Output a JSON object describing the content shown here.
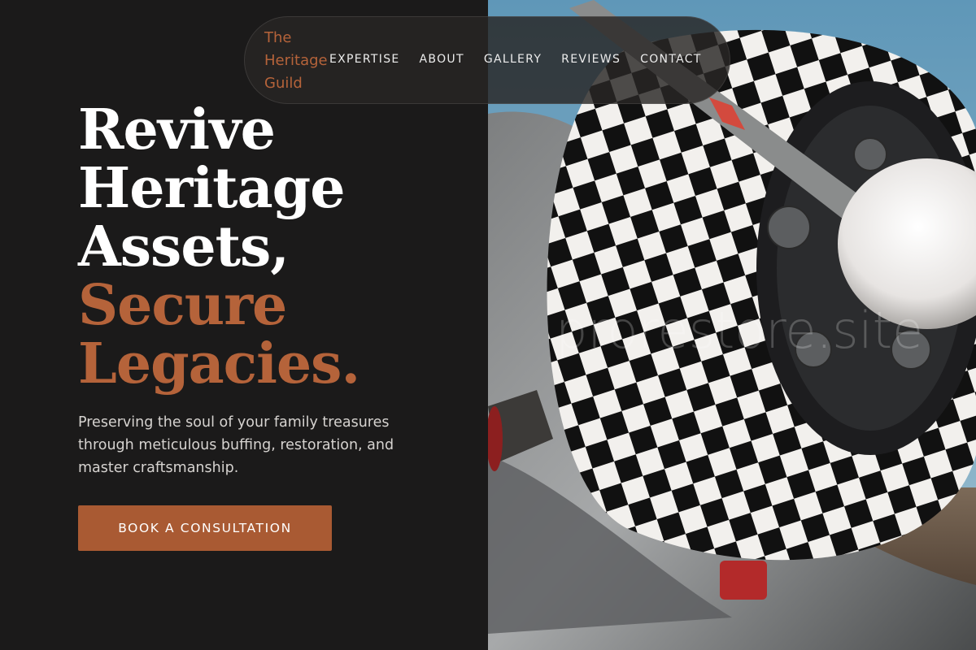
{
  "brand": {
    "line1": "The",
    "line2": "Heritage",
    "line3": "Guild"
  },
  "nav": {
    "items": [
      {
        "label": "EXPERTISE"
      },
      {
        "label": "ABOUT"
      },
      {
        "label": "GALLERY"
      },
      {
        "label": "REVIEWS"
      },
      {
        "label": "CONTACT"
      }
    ]
  },
  "hero": {
    "title_line1": "Revive",
    "title_line2": "Heritage",
    "title_line3": "Assets,",
    "accent_line1": "Secure",
    "accent_line2": "Legacies.",
    "subtitle": "Preserving the soul of your family treasures through meticulous buffing, restoration, and master craftsmanship.",
    "cta_label": "BOOK A CONSULTATION"
  },
  "watermark": "prorestore.site",
  "colors": {
    "background": "#1b1a1a",
    "accent": "#b5633a",
    "button": "#a95a33",
    "text": "#ffffff"
  }
}
